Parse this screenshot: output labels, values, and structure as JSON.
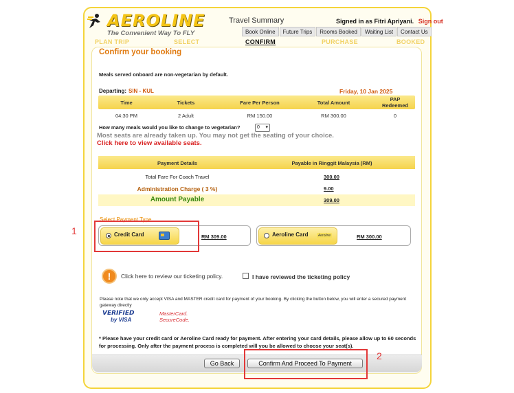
{
  "brand": {
    "name": "AEROLINE",
    "tagline": "The Convenient Way To FLY"
  },
  "header": {
    "travel_summary": "Travel Summary",
    "signed_in": "Signed in as Fitri Apriyani.",
    "sign_out": "Sign out",
    "nav": [
      "Book Online",
      "Future Trips",
      "Rooms Booked",
      "Waiting List",
      "Contact Us"
    ]
  },
  "steps": [
    "PLAN TRIP",
    "SELECT",
    "CONFIRM",
    "PURCHASE",
    "BOOKED"
  ],
  "current_step": "CONFIRM",
  "main": {
    "title": "Confirm your booking",
    "meal_note": "Meals served onboard are non-vegetarian by default.",
    "departing_label": "Departing:",
    "route": "SIN - KUL",
    "date": "Friday, 10 Jan 2025",
    "trip_columns": [
      "Time",
      "Tickets",
      "Fare Per Person",
      "Total Amount",
      "PAP Redeemed"
    ],
    "trip_row": [
      "04:30 PM",
      "2 Adult",
      "RM 150.00",
      "RM 300.00",
      "0"
    ],
    "meal_question": "How many meals would you like to change to vegetarian?",
    "meal_value": "0",
    "seat_warning": "Most seats are already taken up. You may not get the seating of your choice.",
    "seat_link": "Click here to view available seats."
  },
  "payment": {
    "head_left": "Payment Details",
    "head_right": "Payable in Ringgit Malaysia (RM)",
    "rows": [
      {
        "label": "Total Fare For Coach Travel",
        "value": "300.00"
      },
      {
        "label": "Administration Charge ( 3 %)",
        "value": "9.00"
      }
    ],
    "amount_label": "Amount Payable",
    "amount_value": "309.00"
  },
  "payment_type": {
    "title": "Select Payment Type",
    "credit_label": "Credit Card",
    "credit_amount": "RM 309.00",
    "aero_label": "Aeroline Card",
    "aero_icon_text": "Aeroline",
    "aero_amount": "RM 300.00"
  },
  "policy": {
    "icon": "!",
    "link": "Click here to review our ticketing policy.",
    "checkbox_label": "I have reviewed the ticketing policy"
  },
  "visa_note": "Please note that we only accept VISA and MASTER credit card for payment of your booking. By clicking the button below, you will enter a secured payment gateway directly",
  "logos": {
    "visa_top": "VERIFIED",
    "visa_bot": "by VISA",
    "mc_top": "MasterCard.",
    "mc_bot": "SecureCode."
  },
  "final_note": "* Please have your credit card or Aeroline Card ready for payment. After entering your card details, please allow up to 60 seconds for processing. Only after the payment process is completed will you be allowed to choose your seat(s).",
  "buttons": {
    "back": "Go Back",
    "confirm": "Confirm And Proceed To Payment"
  },
  "annotations": {
    "one": "1",
    "two": "2"
  },
  "colors": {
    "accent": "#f4d43a",
    "title_orange": "#e07b12",
    "link_red": "#d81f1f",
    "annotation_red": "#e23838"
  }
}
